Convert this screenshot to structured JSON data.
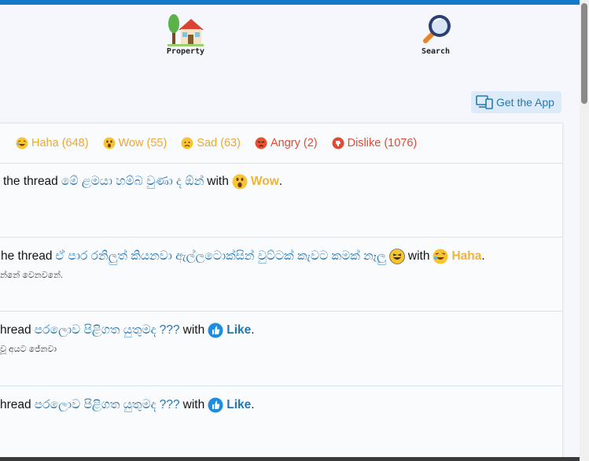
{
  "nav": {
    "property_label": "Property",
    "search_label": "Search"
  },
  "get_app": {
    "label": "Get the App"
  },
  "tabs": [
    {
      "label": "Haha (648)",
      "icon": "haha-emoji-icon"
    },
    {
      "label": "Wow (55)",
      "icon": "wow-emoji-icon"
    },
    {
      "label": "Sad (63)",
      "icon": "sad-emoji-icon"
    },
    {
      "label": "Angry (2)",
      "icon": "angry-emoji-icon"
    },
    {
      "label": "Dislike (1076)",
      "icon": "dislike-icon"
    }
  ],
  "rows": [
    {
      "prefix": "the thread",
      "thread_title": "මේ ළමයා හම්බ වුණා ද ඕන්",
      "with": "with",
      "reaction": "Wow",
      "suffix": ".",
      "snippet": ""
    },
    {
      "prefix": "he thread",
      "thread_title": "ඒ පාර රනිලුත් කියනවා ඇල්ලටොක්සින් වුට්ටක් කැවට කමක් නෑලු",
      "with": "with",
      "reaction": "Haha",
      "suffix": ".",
      "snippet": "න්නේ වෙනවනේ."
    },
    {
      "prefix": "hread",
      "thread_title": "පරලොව පිළිගත යුතුමද ???",
      "with": "with",
      "reaction": "Like",
      "suffix": ".",
      "snippet": "වූ අයට ජේනවා"
    },
    {
      "prefix": "hread",
      "thread_title": "පරලොව පිළිගත යුතුමද ???",
      "with": "with",
      "reaction": "Like",
      "suffix": ".",
      "snippet": ""
    }
  ],
  "colors": {
    "accent": "#1379c9",
    "link": "#2577b1",
    "reaction_gold": "#f0b33a",
    "reaction_red": "#e04b33"
  }
}
